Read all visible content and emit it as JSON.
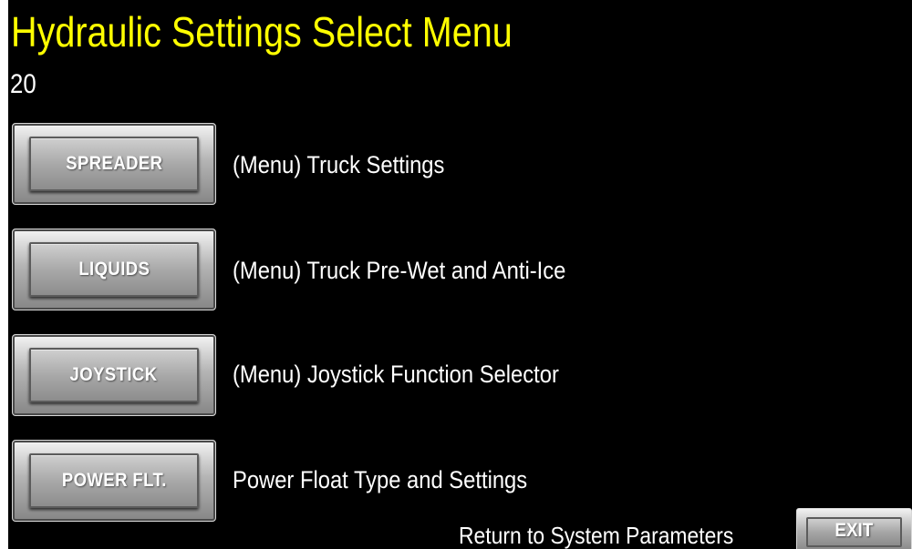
{
  "header": {
    "title": "Hydraulic Settings Select Menu",
    "screen_number": "20"
  },
  "menu": {
    "rows": [
      {
        "button_label": "SPREADER",
        "description": "(Menu) Truck Settings"
      },
      {
        "button_label": "LIQUIDS",
        "description": "(Menu) Truck Pre-Wet and Anti-Ice"
      },
      {
        "button_label": "JOYSTICK",
        "description": "(Menu) Joystick Function Selector"
      },
      {
        "button_label": "POWER FLT.",
        "description": "Power Float Type and Settings"
      }
    ]
  },
  "footer": {
    "return_label": "Return to System Parameters",
    "exit_label": "EXIT"
  },
  "colors": {
    "title": "#ffff00",
    "background": "#000000",
    "text": "#ffffff"
  }
}
